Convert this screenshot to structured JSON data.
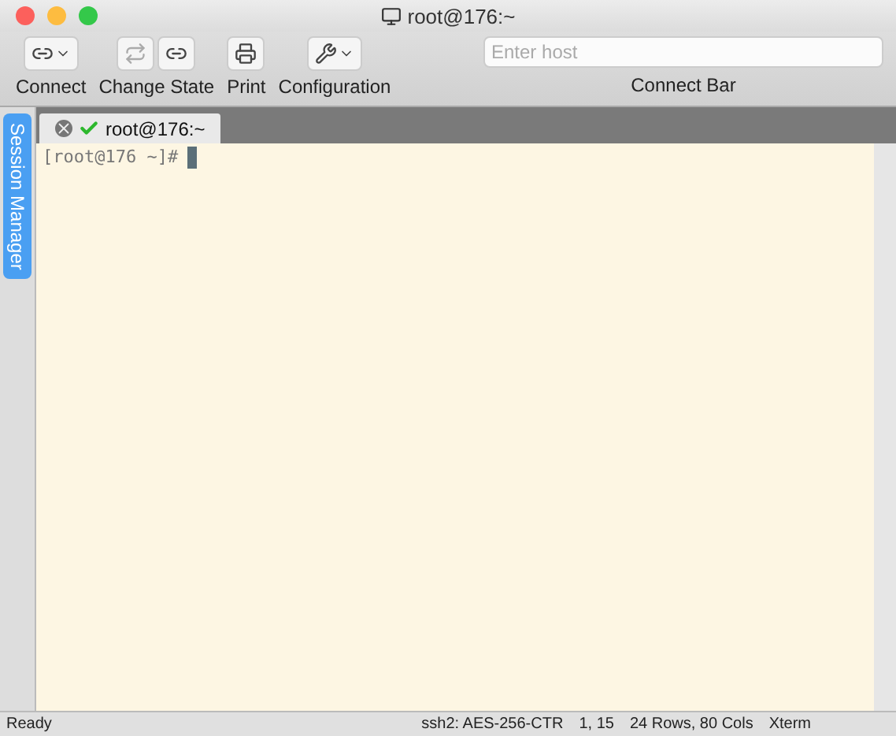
{
  "window": {
    "title": "root@176:~"
  },
  "toolbar": [
    {
      "kind": "connect",
      "label": "Connect"
    },
    {
      "kind": "state",
      "label": "Change State"
    },
    {
      "kind": "print",
      "label": "Print"
    },
    {
      "kind": "config",
      "label": "Configuration"
    }
  ],
  "connect_bar": {
    "placeholder": "Enter host",
    "label": "Connect Bar"
  },
  "side_tab": {
    "label": "Session Manager"
  },
  "tabs": [
    {
      "label": "root@176:~",
      "selected": true,
      "connected": true
    }
  ],
  "terminal": {
    "prompt": "[root@176 ~]#"
  },
  "status_bar": {
    "left": "Ready",
    "items": [
      "ssh2: AES-256-CTR",
      "1, 15",
      "24 Rows, 80 Cols",
      "Xterm"
    ]
  }
}
